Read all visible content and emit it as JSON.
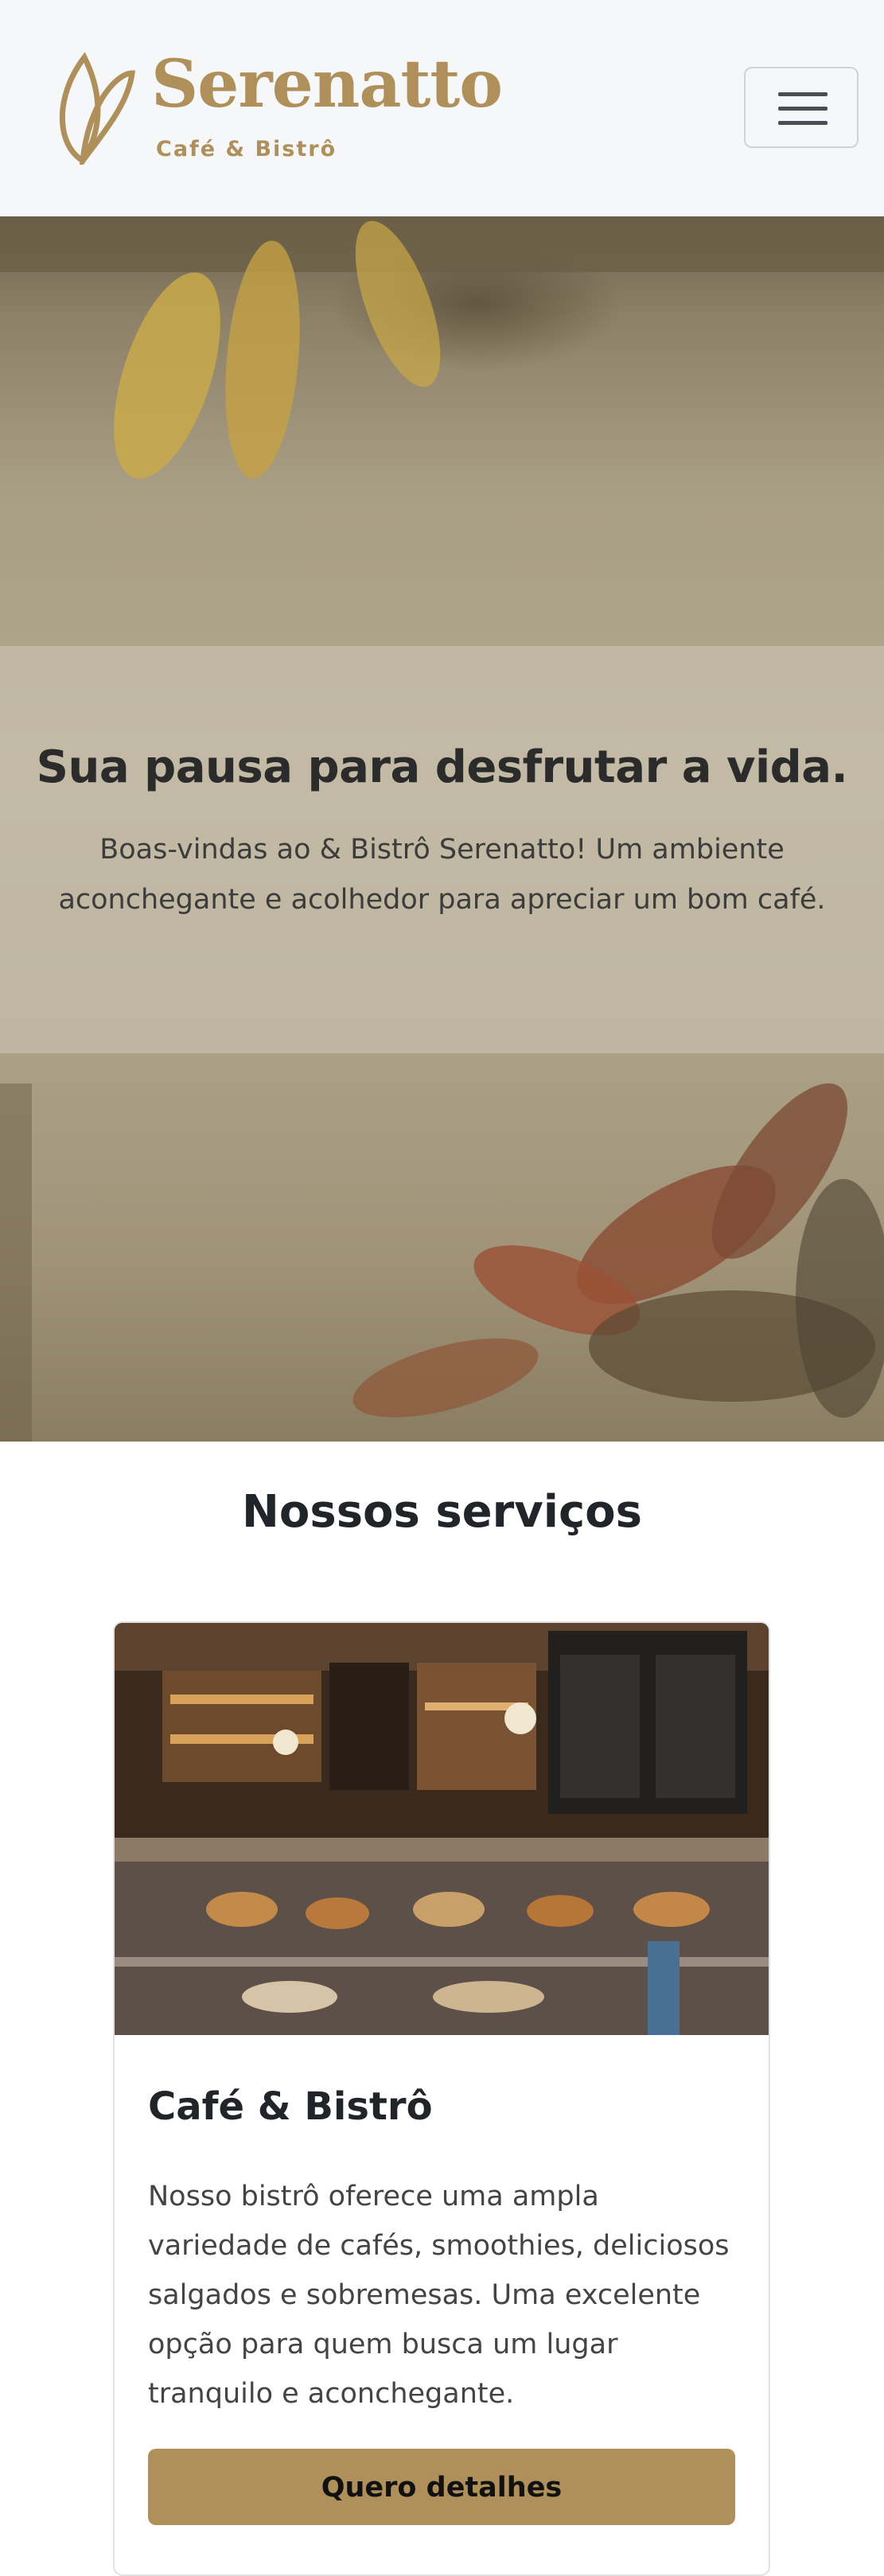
{
  "header": {
    "logo_title": "Serenatto",
    "logo_subtitle": "Café & Bistrô",
    "menu_icon": "hamburger-menu-icon"
  },
  "hero": {
    "title": "Sua pausa para desfrutar a vida.",
    "text": "Boas-vindas ao & Bistrô Serenatto! Um ambiente aconchegante e acolhedor para apreciar um bom café."
  },
  "services": {
    "title": "Nossos serviços",
    "cards": [
      {
        "title": "Café & Bistrô",
        "text": "Nosso bistrô oferece uma ampla variedade de cafés, smoothies, deliciosos salgados e sobremesas. Uma excelente opção para quem busca um lugar tranquilo e aconchegante.",
        "button": "Quero detalhes"
      }
    ]
  },
  "colors": {
    "brand": "#b0905a",
    "header_bg": "#f6f7f9"
  }
}
